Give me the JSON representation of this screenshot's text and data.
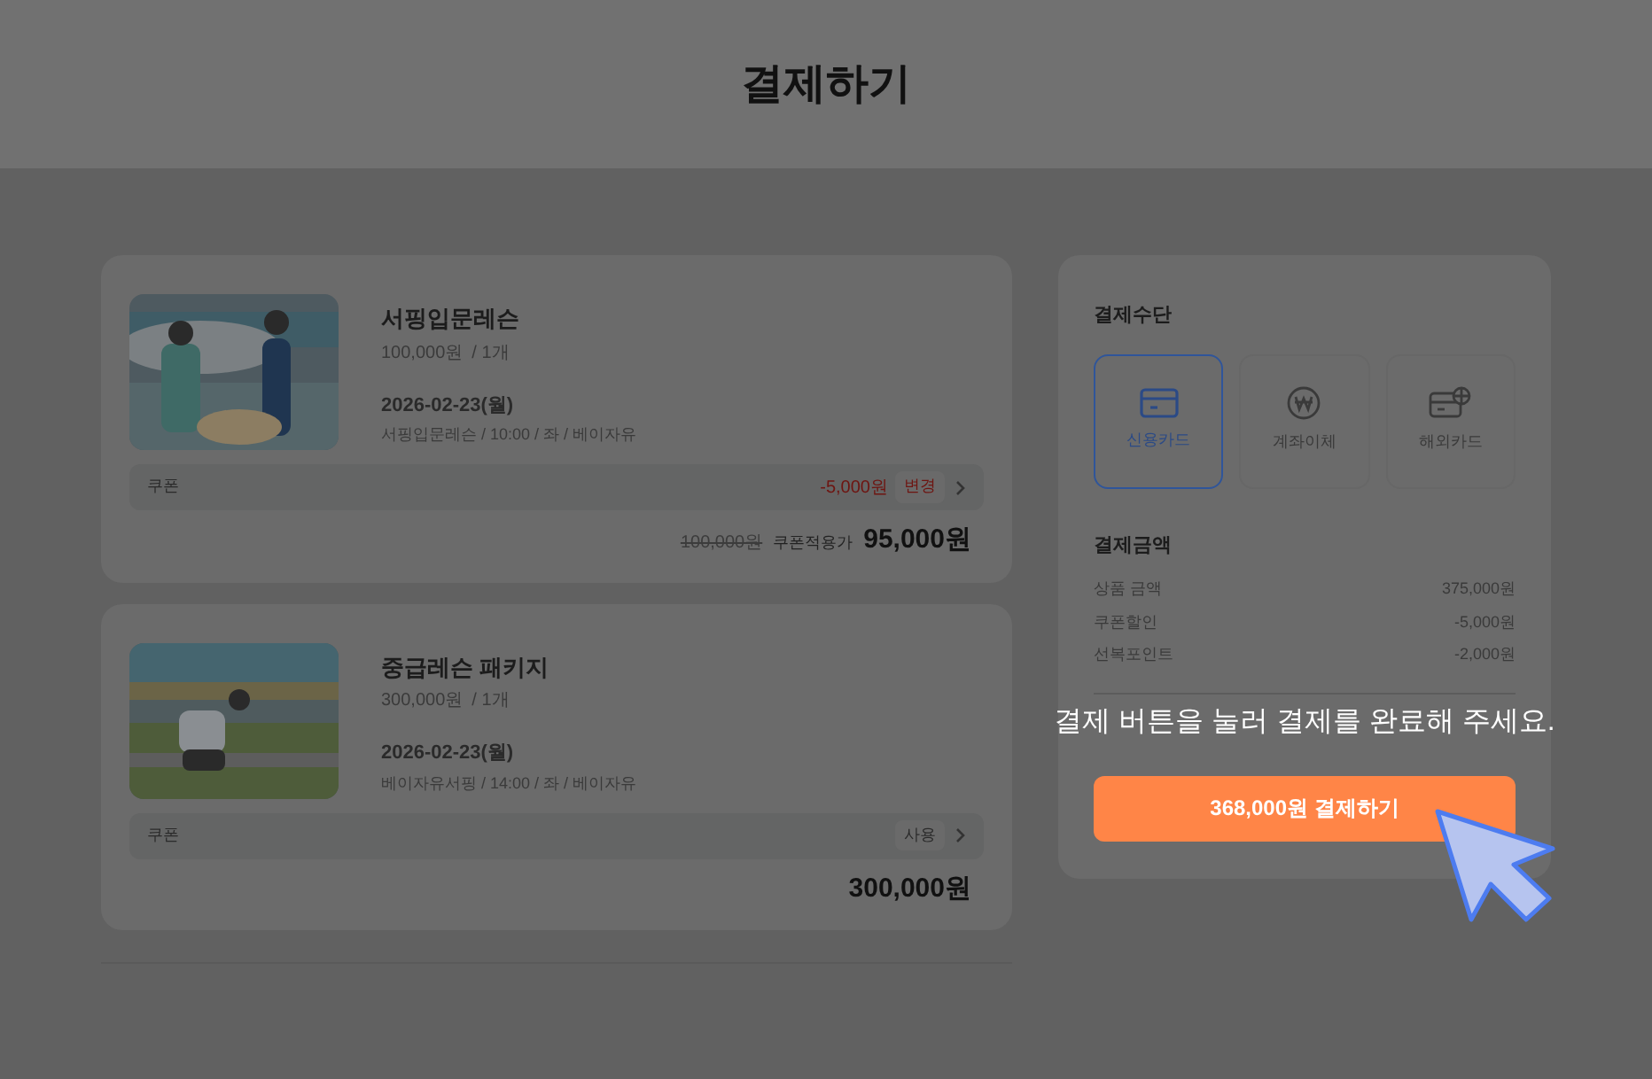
{
  "header": {
    "title": "결제하기"
  },
  "items": [
    {
      "name": "서핑입문레슨",
      "price": "100,000원",
      "qty": "/ 1개",
      "date": "2026-02-23(월)",
      "detail": "서핑입문레슨 / 10:00 / 좌 / 베이자유",
      "coupon": {
        "label": "쿠폰",
        "discount": "-5,000원",
        "action": "변경"
      },
      "original_price": "100,000원",
      "applied_label": "쿠폰적용가",
      "final_price": "95,000원"
    },
    {
      "name": "중급레슨 패키지",
      "price": "300,000원",
      "qty": "/ 1개",
      "date": "2026-02-23(월)",
      "detail": "베이자유서핑 / 14:00 / 좌 / 베이자유",
      "coupon": {
        "label": "쿠폰",
        "action": "사용"
      },
      "final_price": "300,000원"
    }
  ],
  "payment": {
    "title": "결제수단",
    "methods": [
      {
        "kind": "card",
        "label": "신용카드",
        "selected": true
      },
      {
        "kind": "won",
        "label": "계좌이체",
        "selected": false
      },
      {
        "kind": "global",
        "label": "해외카드",
        "selected": false
      }
    ],
    "amount_title": "결제금액",
    "amounts": [
      {
        "label": "상품 금액",
        "value": "375,000원"
      },
      {
        "label": "쿠폰할인",
        "value": "-5,000원"
      },
      {
        "label": "선복포인트",
        "value": "-2,000원"
      }
    ],
    "pay_button": "368,000원 결제하기"
  },
  "guide": {
    "text": "결제 버튼을 눌러 결제를 완료해 주세요."
  }
}
